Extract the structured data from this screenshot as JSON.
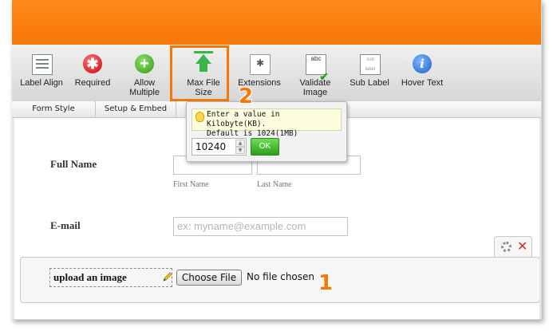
{
  "toolbar": {
    "items": [
      {
        "label": "Label Align",
        "icon": "label-align-icon"
      },
      {
        "label": "Required",
        "icon": "required-icon"
      },
      {
        "label": "Allow\nMultiple",
        "icon": "allow-multiple-icon"
      },
      {
        "label": "Max File\nSize",
        "icon": "max-file-size-icon"
      },
      {
        "label": "Extensions",
        "icon": "extensions-icon"
      },
      {
        "label": "Validate\nImage",
        "icon": "validate-image-icon"
      },
      {
        "label": "Sub Label",
        "icon": "sub-label-icon"
      },
      {
        "label": "Hover Text",
        "icon": "hover-text-icon"
      }
    ],
    "highlight_color": "#f77807"
  },
  "validate_icon_text": "abc",
  "sub_label_icon_text": "sub label",
  "tabs": [
    "Form Style",
    "Setup & Embed"
  ],
  "tooltip": {
    "message": "Enter a value in Kilobyte(KB).\nDefault is 1024(1MB)",
    "value": "10240",
    "ok_label": "OK"
  },
  "form": {
    "full_name_label": "Full Name",
    "first_name_sublabel": "First Name",
    "last_name_sublabel": "Last Name",
    "email_label": "E-mail",
    "email_placeholder": "ex: myname@example.com",
    "upload_label": "upload an image",
    "choose_file_label": "Choose File",
    "no_file_text": "No file chosen"
  },
  "annotations": {
    "one": "1",
    "two": "2"
  },
  "colors": {
    "orange": "#f77807",
    "ok_green": "#2c9f1a",
    "close_red": "#d72a2a"
  }
}
